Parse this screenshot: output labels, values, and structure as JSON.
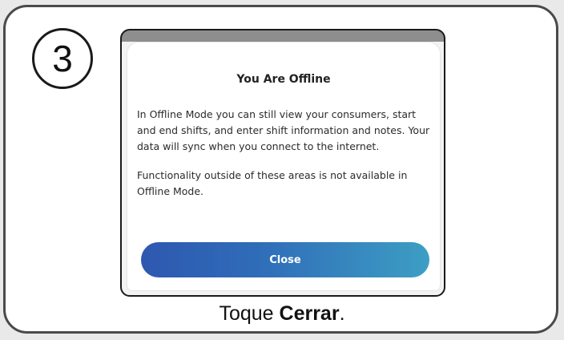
{
  "step": {
    "number": "3"
  },
  "dialog": {
    "title": "You Are Offline",
    "paragraph1": "In Offline Mode you can still view your consumers, start and end shifts, and enter shift information and notes. Your data will sync when you connect to the internet.",
    "paragraph2": "Functionality outside of these areas is not available in Offline Mode.",
    "close_label": "Close"
  },
  "caption": {
    "prefix": "Toque ",
    "bold": "Cerrar",
    "suffix": "."
  },
  "colors": {
    "button_gradient_start": "#2e58b0",
    "button_gradient_end": "#3d9ec4",
    "frame_border": "#4a4a4a"
  }
}
